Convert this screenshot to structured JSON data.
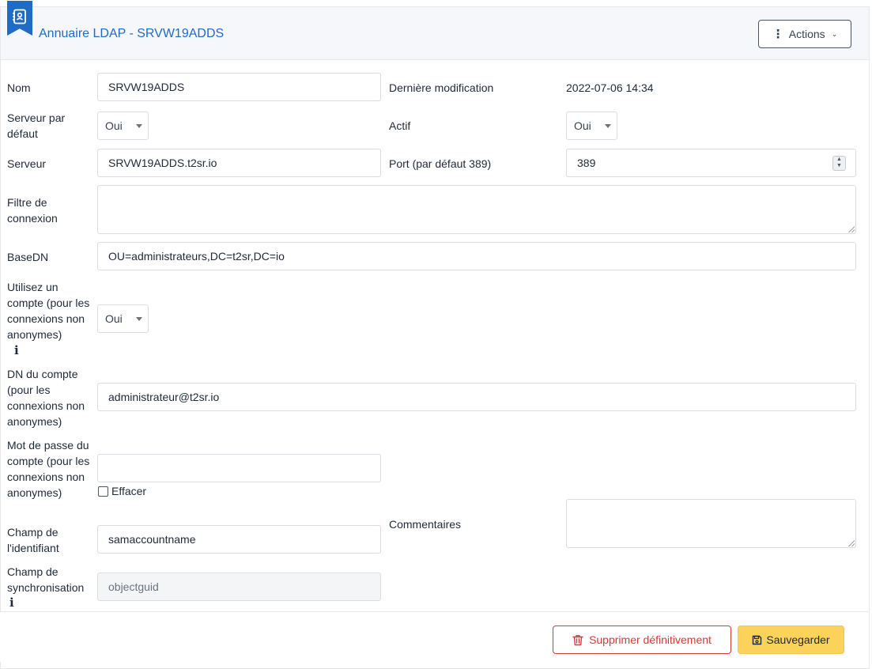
{
  "header": {
    "icon": "address-book-icon",
    "title": "Annuaire LDAP - SRVW19ADDS",
    "actions_label": "Actions",
    "actions_icon": "vertical-dots-icon",
    "actions_chevron": "chevron-down-icon"
  },
  "form": {
    "nom": {
      "label": "Nom",
      "value": "SRVW19ADDS"
    },
    "derniere_modification": {
      "label": "Dernière modification",
      "value": "2022-07-06 14:34"
    },
    "serveur_par_defaut": {
      "label": "Serveur par défaut",
      "value": "Oui"
    },
    "actif": {
      "label": "Actif",
      "value": "Oui"
    },
    "serveur": {
      "label": "Serveur",
      "value": "SRVW19ADDS.t2sr.io"
    },
    "port": {
      "label": "Port (par défaut 389)",
      "value": "389"
    },
    "filtre_connexion": {
      "label": "Filtre de connexion",
      "value": ""
    },
    "basedn": {
      "label": "BaseDN",
      "value": "OU=administrateurs,DC=t2sr,DC=io"
    },
    "utilisez_compte": {
      "label": "Utilisez un compte (pour les connexions non anonymes)",
      "value": "Oui",
      "info_icon": "info-icon"
    },
    "dn_compte": {
      "label": "DN du compte (pour les connexions non anonymes)",
      "value": "administrateur@t2sr.io"
    },
    "mot_de_passe": {
      "label": "Mot de passe du compte (pour les connexions non anonymes)",
      "value": "",
      "effacer_label": "Effacer",
      "effacer_checked": false
    },
    "commentaires": {
      "label": "Commentaires",
      "value": ""
    },
    "champ_identifiant": {
      "label": "Champ de l'identifiant",
      "value": "samaccountname"
    },
    "champ_synchronisation": {
      "label": "Champ de synchronisation",
      "placeholder": "objectguid",
      "info_icon": "info-icon"
    }
  },
  "footer": {
    "delete_label": "Supprimer définitivement",
    "delete_icon": "trash-icon",
    "save_label": "Sauvegarder",
    "save_icon": "floppy-disk-icon"
  },
  "colors": {
    "primary": "#206bc4",
    "danger": "#d63939",
    "warning": "#fbd35a"
  }
}
